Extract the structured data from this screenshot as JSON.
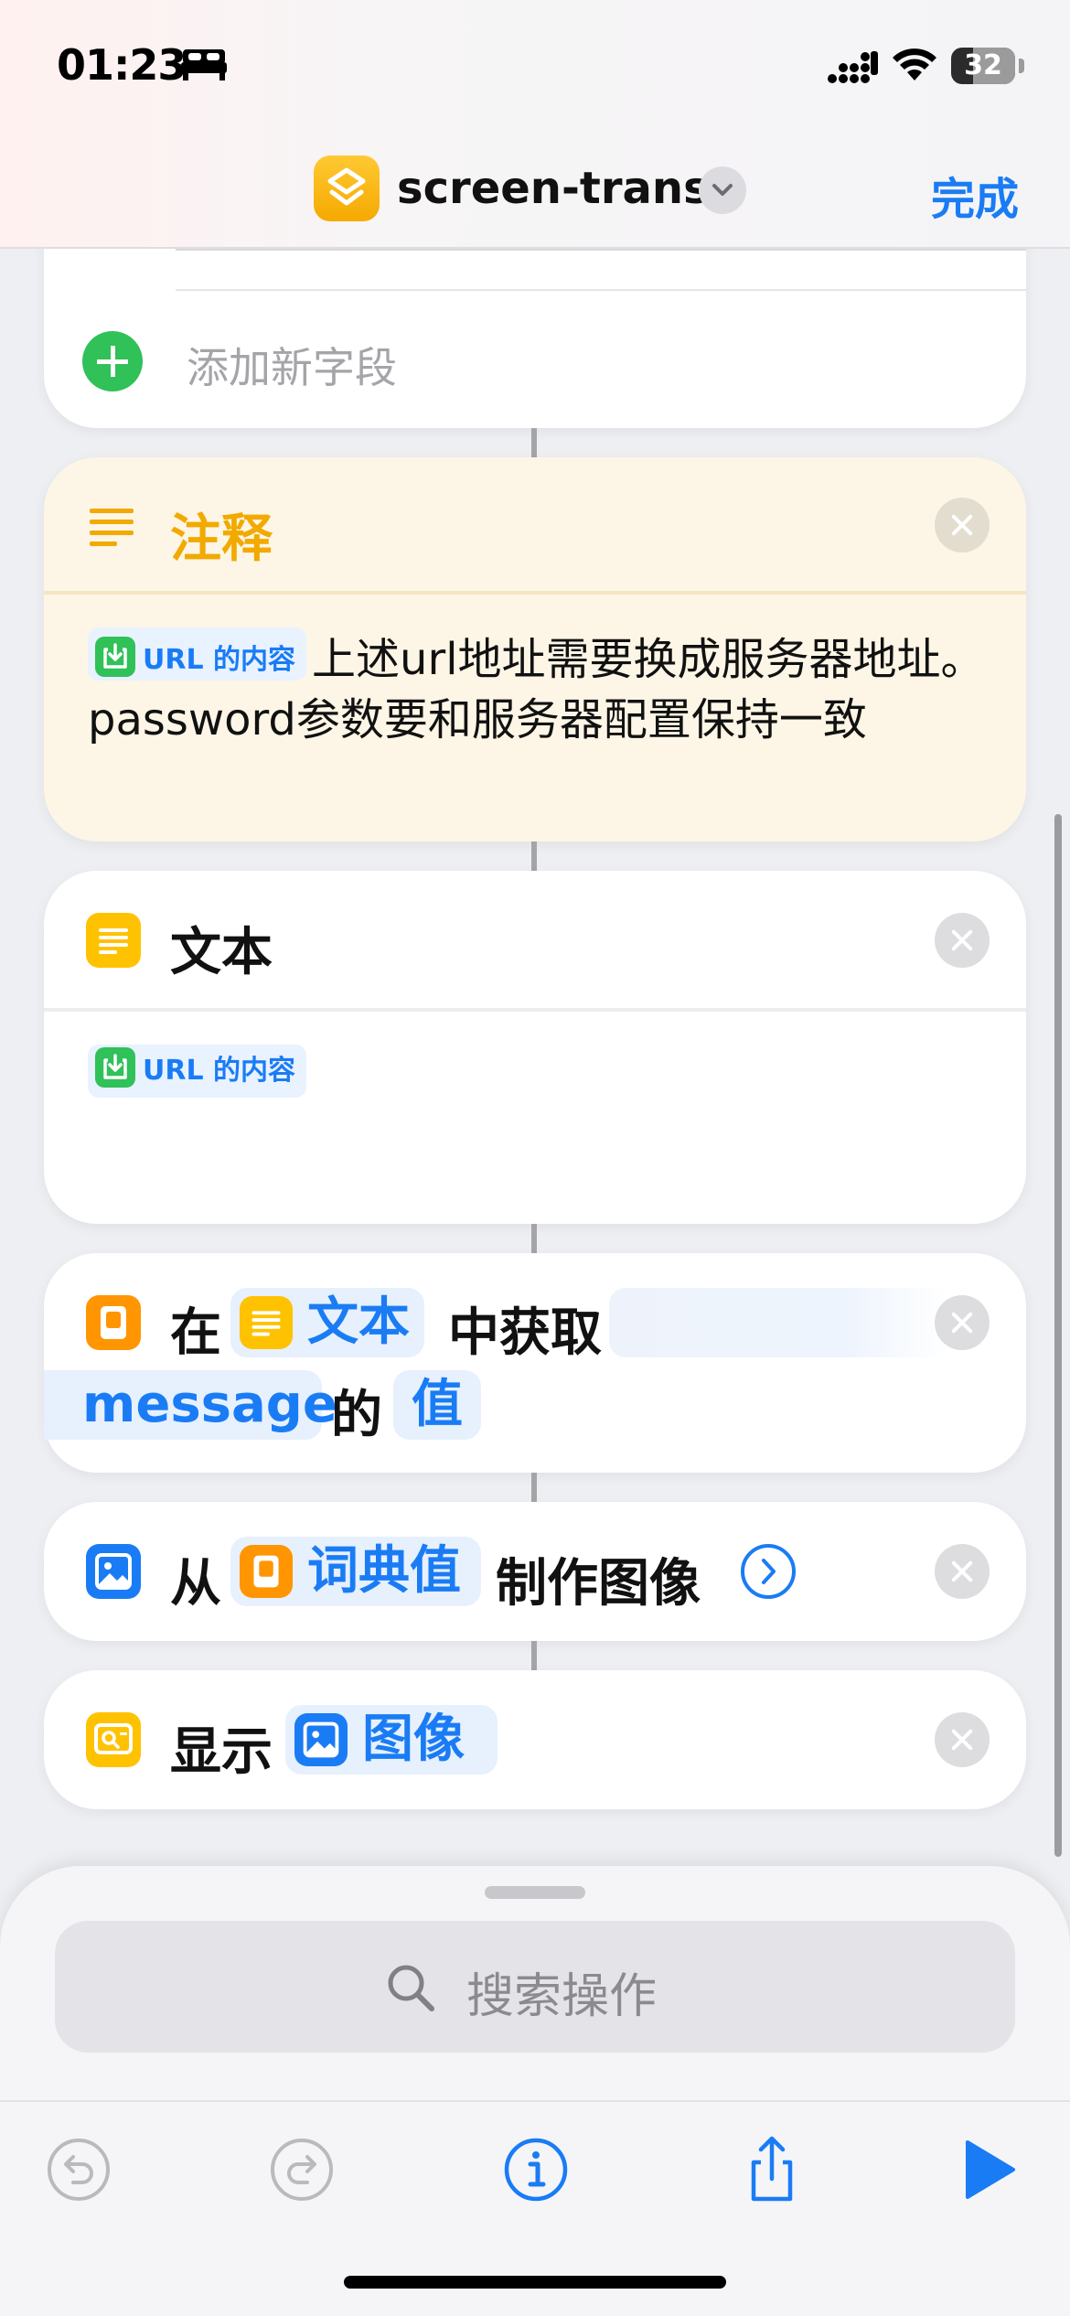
{
  "status_bar": {
    "time": "01:23",
    "battery": "32",
    "icons": [
      "bed-icon",
      "signal-icon",
      "wifi-icon",
      "battery-icon"
    ]
  },
  "nav": {
    "title": "screen-trans",
    "done_label": "完成",
    "app_icon": "shortcuts-layers-icon"
  },
  "dict_card": {
    "add_field_label": "添加新字段"
  },
  "comment_card": {
    "title": "注释",
    "chip_label": "URL 的内容",
    "text": "上述url地址需要换成服务器地址。password参数要和服务器配置保持一致"
  },
  "text_card": {
    "title": "文本",
    "chip_label": "URL 的内容"
  },
  "get_dict_card": {
    "word_in": "在",
    "chip_text": "文本",
    "word_get": "中获取",
    "key_value": "message",
    "word_of": "的",
    "chip_value": "值"
  },
  "make_image_card": {
    "word_from": "从",
    "chip_dict": "词典值",
    "word_make": "制作图像"
  },
  "show_card": {
    "word_show": "显示",
    "chip_image": "图像"
  },
  "sheet": {
    "search_placeholder": "搜索操作"
  },
  "toolbar": {
    "items": [
      "undo-icon",
      "redo-icon",
      "info-icon",
      "share-icon",
      "play-icon"
    ]
  },
  "colors": {
    "accent": "#1a7cf5",
    "comment_yellow": "#f2a900",
    "green": "#30c158",
    "orange": "#ff9500"
  }
}
